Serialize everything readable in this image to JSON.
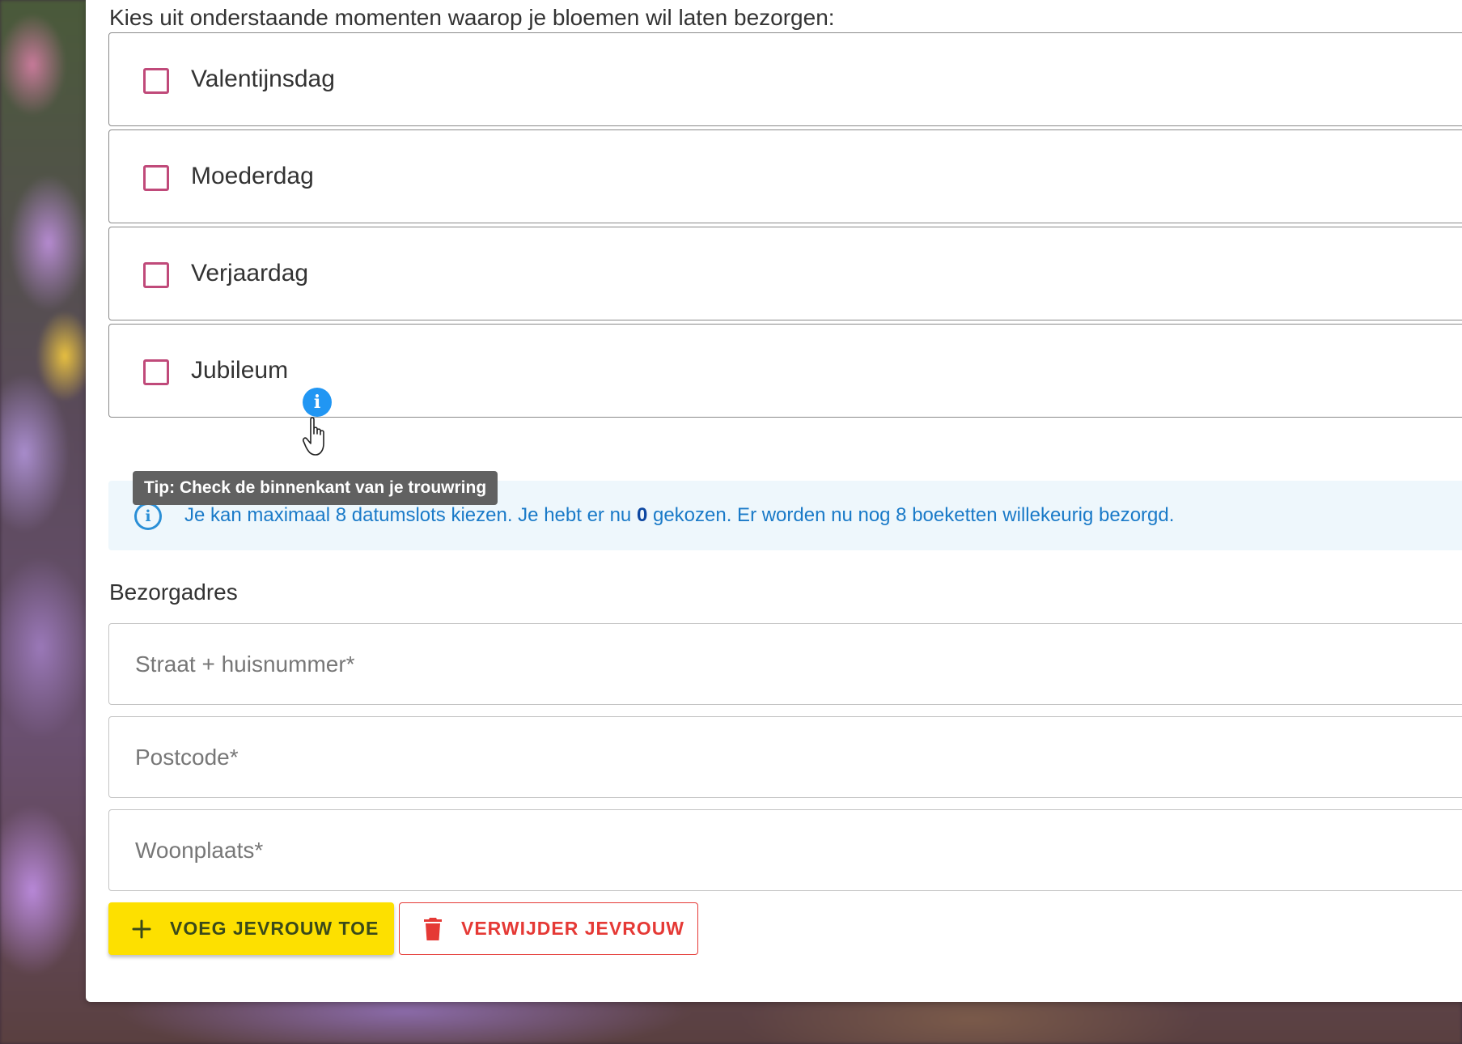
{
  "page": {
    "intro": "Kies uit onderstaande momenten waarop je bloemen wil laten bezorgen:"
  },
  "moments": [
    {
      "label": "Valentijnsdag",
      "checked": false
    },
    {
      "label": "Moederdag",
      "checked": false
    },
    {
      "label": "Verjaardag",
      "checked": false
    },
    {
      "label": "Jubileum",
      "checked": false
    }
  ],
  "tooltip": {
    "text": "Tip: Check de binnenkant van je trouwring"
  },
  "alert": {
    "text_before": "Je kan maximaal 8 datumslots kiezen. Je hebt er nu ",
    "count": "0",
    "text_after": " gekozen. Er worden nu nog 8 boeketten willekeurig bezorgd."
  },
  "address": {
    "title": "Bezorgadres",
    "street_placeholder": "Straat + huisnummer*",
    "postcode_placeholder": "Postcode*",
    "city_placeholder": "Woonplaats*"
  },
  "actions": {
    "add_label": "VOEG JEVROUW TOE",
    "remove_label": "VERWIJDER JEVROUW"
  },
  "colors": {
    "accent": "#c04a7a",
    "info": "#2196f3",
    "add_button": "#fde000",
    "remove_button": "#e53935"
  },
  "icons": {
    "info": "info-icon",
    "cursor": "hand-pointer-icon",
    "add": "plus-icon",
    "remove": "trash-icon"
  }
}
